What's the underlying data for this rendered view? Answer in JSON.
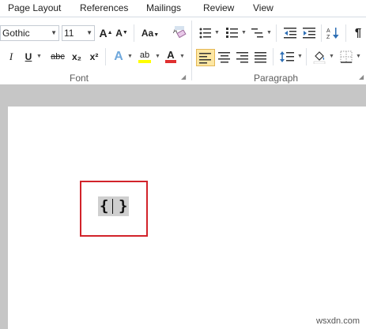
{
  "tabs": [
    "Page Layout",
    "References",
    "Mailings",
    "Review",
    "View"
  ],
  "font": {
    "name": "Gothic",
    "size": "11",
    "grow_label": "A",
    "shrink_label": "A",
    "case_label": "Aa",
    "italic": "I",
    "underline": "U",
    "strike": "abc",
    "subscript": "x₂",
    "superscript": "x²",
    "text_effects": "A",
    "highlight": "ab",
    "font_color": "A",
    "highlight_color": "#ffff00",
    "font_color_bar": "#e03030"
  },
  "groups": {
    "font_label": "Font",
    "paragraph_label": "Paragraph"
  },
  "paragraph": {
    "pilcrow": "¶",
    "align_left_active": true
  },
  "document": {
    "field_left": "{",
    "field_right": "}"
  },
  "watermark": "wsxdn.com",
  "colors": {
    "highlight_box": "#d2232a",
    "active_button": "#fde7a3"
  }
}
